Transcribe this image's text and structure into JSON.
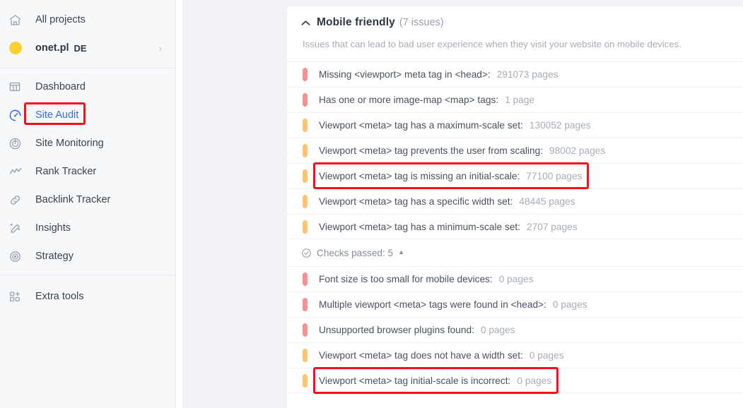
{
  "sidebar": {
    "top_items": [
      {
        "label": "All projects",
        "icon": "home-icon"
      }
    ],
    "project": {
      "name": "onet.pl",
      "locale": "DE",
      "icon": "project-avatar-dot",
      "chevron": "›"
    },
    "nav_items": [
      {
        "label": "Dashboard",
        "icon": "dashboard-icon",
        "active": false
      },
      {
        "label": "Site Audit",
        "icon": "site-audit-icon",
        "active": true
      },
      {
        "label": "Site Monitoring",
        "icon": "site-monitoring-icon",
        "active": false
      },
      {
        "label": "Rank Tracker",
        "icon": "rank-tracker-icon",
        "active": false
      },
      {
        "label": "Backlink Tracker",
        "icon": "backlink-tracker-icon",
        "active": false
      },
      {
        "label": "Insights",
        "icon": "insights-icon",
        "active": false
      },
      {
        "label": "Strategy",
        "icon": "strategy-icon",
        "active": false
      }
    ],
    "extra": {
      "label": "Extra tools",
      "icon": "extra-tools-icon"
    }
  },
  "panel": {
    "section": {
      "collapse_icon": "chevron-up-icon",
      "title": "Mobile friendly",
      "count": "(7 issues)",
      "description": "Issues that can lead to bad user experience when they visit your website on mobile devices."
    },
    "issues": [
      {
        "severity": "high",
        "text": "Missing <viewport> meta tag in <head>:",
        "count": "291073 pages"
      },
      {
        "severity": "high",
        "text": "Has one or more image-map <map> tags:",
        "count": "1 page"
      },
      {
        "severity": "mid",
        "text": "Viewport <meta> tag has a maximum-scale set:",
        "count": "130052 pages"
      },
      {
        "severity": "mid",
        "text": "Viewport <meta> tag prevents the user from scaling:",
        "count": "98002 pages"
      },
      {
        "severity": "mid",
        "text": "Viewport <meta> tag is missing an initial-scale:",
        "count": "77100 pages"
      },
      {
        "severity": "mid",
        "text": "Viewport <meta> tag has a specific width set:",
        "count": "48445 pages"
      },
      {
        "severity": "mid",
        "text": "Viewport <meta> tag has a minimum-scale set:",
        "count": "2707 pages"
      }
    ],
    "checks_passed": {
      "icon": "check-circle-icon",
      "label": "Checks passed: 5",
      "caret": "▲"
    },
    "passed_items": [
      {
        "severity": "high",
        "text": "Font size is too small for mobile devices:",
        "count": "0 pages"
      },
      {
        "severity": "high",
        "text": "Multiple viewport <meta> tags were found in <head>:",
        "count": "0 pages"
      },
      {
        "severity": "high",
        "text": "Unsupported browser plugins found:",
        "count": "0 pages"
      },
      {
        "severity": "mid",
        "text": "Viewport <meta> tag does not have a width set:",
        "count": "0 pages"
      },
      {
        "severity": "mid",
        "text": "Viewport <meta> tag initial-scale is incorrect:",
        "count": "0 pages"
      }
    ]
  },
  "highlights": {
    "color": "#fc0d1c",
    "targets": [
      "Site Audit",
      "Viewport <meta> tag is missing an initial-scale",
      "Viewport <meta> tag initial-scale is incorrect"
    ]
  },
  "colors": {
    "accent": "#2f6fed",
    "severity_high": "#f79090",
    "severity_mid": "#fbc571",
    "sidebar_bg": "#f7f8fa",
    "gap_bg": "#f1f2f5"
  }
}
